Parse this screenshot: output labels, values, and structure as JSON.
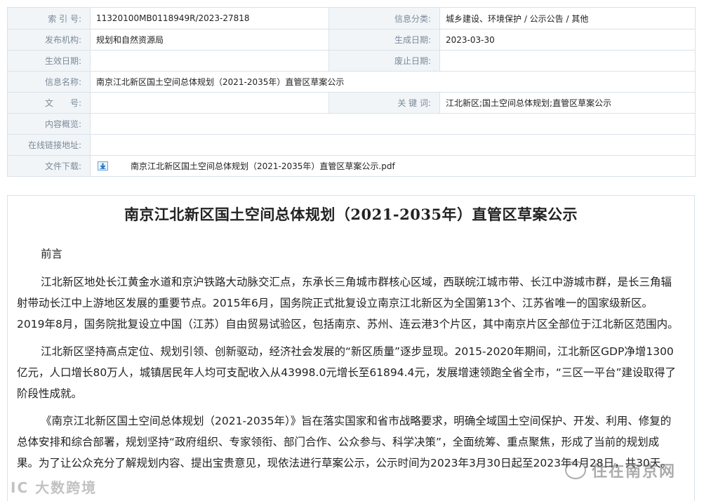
{
  "meta": {
    "index_no_label": "索 引 号:",
    "index_no": "11320100MB0118949R/2023-27818",
    "category_label": "信息分类:",
    "category": "城乡建设、环境保护 / 公示公告 / 其他",
    "publisher_label": "发布机构:",
    "publisher": "规划和自然资源局",
    "created_label": "生成日期:",
    "created": "2023-03-30",
    "effective_label": "生效日期:",
    "effective": "",
    "expiry_label": "废止日期:",
    "expiry": "",
    "info_name_label": "信息名称:",
    "info_name": "南京江北新区国土空间总体规划（2021-2035年）直管区草案公示",
    "doc_no_label": "文　　号:",
    "doc_no": "",
    "keywords_label": "关 键 词:",
    "keywords": "江北新区;国土空间总体规划;直管区草案公示",
    "summary_label": "内容概览:",
    "summary": "",
    "online_link_label": "在线链接地址:",
    "online_link": "",
    "download_label": "文件下载:",
    "download_file": "南京江北新区国土空间总体规划（2021-2035年）直管区草案公示.pdf",
    "download_icon": "download-icon"
  },
  "article": {
    "title": "南京江北新区国土空间总体规划（2021-2035年）直管区草案公示",
    "preface_heading": "前言",
    "paragraphs": [
      "江北新区地处长江黄金水道和京沪铁路大动脉交汇点，东承长三角城市群核心区域，西联皖江城市带、长江中游城市群，是长三角辐射带动长江中上游地区发展的重要节点。2015年6月，国务院正式批复设立南京江北新区为全国第13个、江苏省唯一的国家级新区。2019年8月，国务院批复设立中国（江苏）自由贸易试验区，包括南京、苏州、连云港3个片区，其中南京片区全部位于江北新区范围内。",
      "江北新区坚持高点定位、规划引领、创新驱动，经济社会发展的“新区质量”逐步显现。2015-2020年期间，江北新区GDP净增1300亿元，人口增长80万人，城镇居民年人均可支配收入从43998.0元增长至61894.4元，发展增速领跑全省全市，“三区一平台”建设取得了阶段性成就。",
      "《南京江北新区国土空间总体规划（2021-2035年）》旨在落实国家和省市战略要求，明确全域国土空间保护、开发、利用、修复的总体安排和综合部署，规划坚持“政府组织、专家领衔、部门合作、公众参与、科学决策”，全面统筹、重点聚焦，形成了当前的规划成果。为了让公众充分了解规划内容、提出宝贵意见，现依法进行草案公示，公示时间为2023年3月30日起至2023年4月28日，共30天。"
    ]
  },
  "watermarks": {
    "left": "IC 大数跨境",
    "right": "住在南京网"
  }
}
